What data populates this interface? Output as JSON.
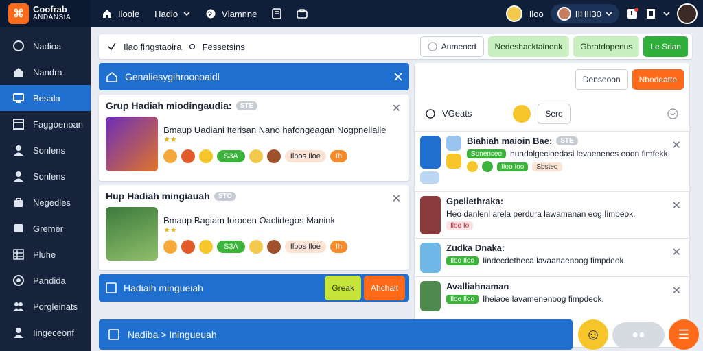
{
  "app": {
    "logo_line1": "Coofrab",
    "logo_line2": "ANDANSIA"
  },
  "topnav": [
    {
      "label": "Iloole",
      "icon": "home-icon"
    },
    {
      "label": "Hadio",
      "icon": "chevron-down-icon"
    },
    {
      "label": "Vlamnne",
      "icon": "globe-icon"
    },
    {
      "label": "",
      "icon": "bookmark-icon"
    },
    {
      "label": "",
      "icon": "briefcase-icon"
    }
  ],
  "user": {
    "label1": "Iloo",
    "label2": "IIHII30"
  },
  "sidebar": [
    {
      "label": "Nadioa",
      "icon": "circle-icon"
    },
    {
      "label": "Nandra",
      "icon": "home-icon"
    },
    {
      "label": "Besala",
      "icon": "monitor-icon"
    },
    {
      "label": "Faggoenoan",
      "icon": "layout-icon"
    },
    {
      "label": "Sonlens",
      "icon": "user-icon"
    },
    {
      "label": "Sonlens",
      "icon": "user-icon"
    },
    {
      "label": "Negedles",
      "icon": "bag-icon"
    },
    {
      "label": "Gremer",
      "icon": "box-icon"
    },
    {
      "label": "Pluhe",
      "icon": "grid-icon"
    },
    {
      "label": "Pandida",
      "icon": "circle-icon"
    },
    {
      "label": "Porgleinats",
      "icon": "users-icon"
    },
    {
      "label": "Iingeceonf",
      "icon": "user-icon"
    }
  ],
  "toolbar": {
    "left1": "Ilao fingstaoira",
    "left2": "Fessetsins",
    "btn1": "Aumeocd",
    "btn2": "Nedeshacktainenk",
    "btn3": "Gbratdopenus",
    "btn4": "Le Srlan"
  },
  "left_header": "Genaliesygihroocoaidl",
  "cards": [
    {
      "title": "Grup Hadiah miodingaudia:",
      "badge": "STE",
      "desc": "Bmaup Uadiani Iterisan Nano hafongeagan Nogpnelialle",
      "chip_green": "S3A",
      "chip_peach": "Ilbos Iloe",
      "chip_orange": "Ih"
    },
    {
      "title": "Hup Hadiah mingiauah",
      "badge": "STO",
      "desc": "Bmaup Bagiam Iorocen Oaclidegos Manink",
      "chip_green": "S3A",
      "chip_peach": "Ilbos Iloe",
      "chip_orange": "Ih"
    }
  ],
  "section2": {
    "title": "Hadiaih mingueiah",
    "btn_lime": "Greak",
    "btn_orange": "Ahchait"
  },
  "right_panel": {
    "btn_outline": "Denseoon",
    "btn_orange": "Nbodeatte",
    "filter_label": "VGeats",
    "filter_btn": "Sere"
  },
  "rows": [
    {
      "title": "Biahiah maioin Bae:",
      "badge": "STE",
      "tag": "Sonenceo",
      "text": "huadolgecioedasi levaenenes eoon fimfekk.",
      "chip": "IIoo Ioo",
      "chip2": "Sbsteo"
    },
    {
      "title": "Gpellethraka:",
      "badge": "",
      "tag": "Iloo Io",
      "text": "Heo danlenl arela perdura lawamanan eog Iimbeok."
    },
    {
      "title": "Zudka Dnaka:",
      "badge": "",
      "tag": "Iloo Iloo",
      "text": "Iindecdetheca lavaanaenoog fimpdeok."
    },
    {
      "title": "Avalliahnaman",
      "badge": "",
      "tag": "Iloe Iloo",
      "text": "Iheiaoe lavamenenoog fimpdeok."
    }
  ],
  "bottom_bar": {
    "title": "Nadiba > Iningueuah"
  },
  "colors": {
    "primary": "#1f6fd1",
    "dark": "#0f1f3a",
    "orange": "#ff6a1a",
    "green": "#2fae3a"
  }
}
